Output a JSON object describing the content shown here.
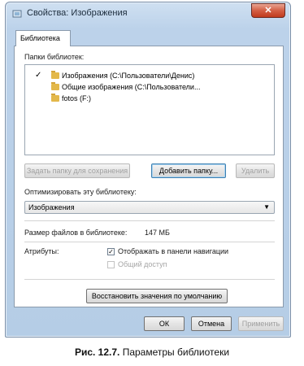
{
  "window": {
    "title": "Свойства: Изображения",
    "close_label": "✕"
  },
  "tabs": [
    {
      "label": "Библиотека",
      "active": true
    }
  ],
  "library": {
    "folders_label": "Папки библиотек:",
    "folders": [
      {
        "checked": true,
        "label": "Изображения (C:\\Пользователи\\Денис)"
      },
      {
        "checked": false,
        "label": "Общие изображения (C:\\Пользователи..."
      },
      {
        "checked": false,
        "label": "fotos (F:)"
      }
    ],
    "buttons": {
      "set_save_folder": "Задать папку для сохранения",
      "add_folder": "Добавить папку...",
      "remove": "Удалить"
    },
    "optimize_label": "Оптимизировать эту библиотеку:",
    "optimize_value": "Изображения",
    "size_label": "Размер файлов в библиотеке:",
    "size_value": "147 МБ",
    "attributes_label": "Атрибуты:",
    "attr_show_nav": {
      "label": "Отображать в панели навигации",
      "checked": true
    },
    "attr_shared": {
      "label": "Общий доступ",
      "checked": false,
      "disabled": true
    },
    "restore_defaults": "Восстановить значения по умолчанию"
  },
  "footer": {
    "ok": "ОК",
    "cancel": "Отмена",
    "apply": "Применить"
  },
  "caption": {
    "prefix": "Рис. 12.7.",
    "text": " Параметры библиотеки"
  },
  "colors": {
    "frame": "#b5cde6",
    "close": "#c03a1d",
    "folder": "#e3b84a"
  }
}
